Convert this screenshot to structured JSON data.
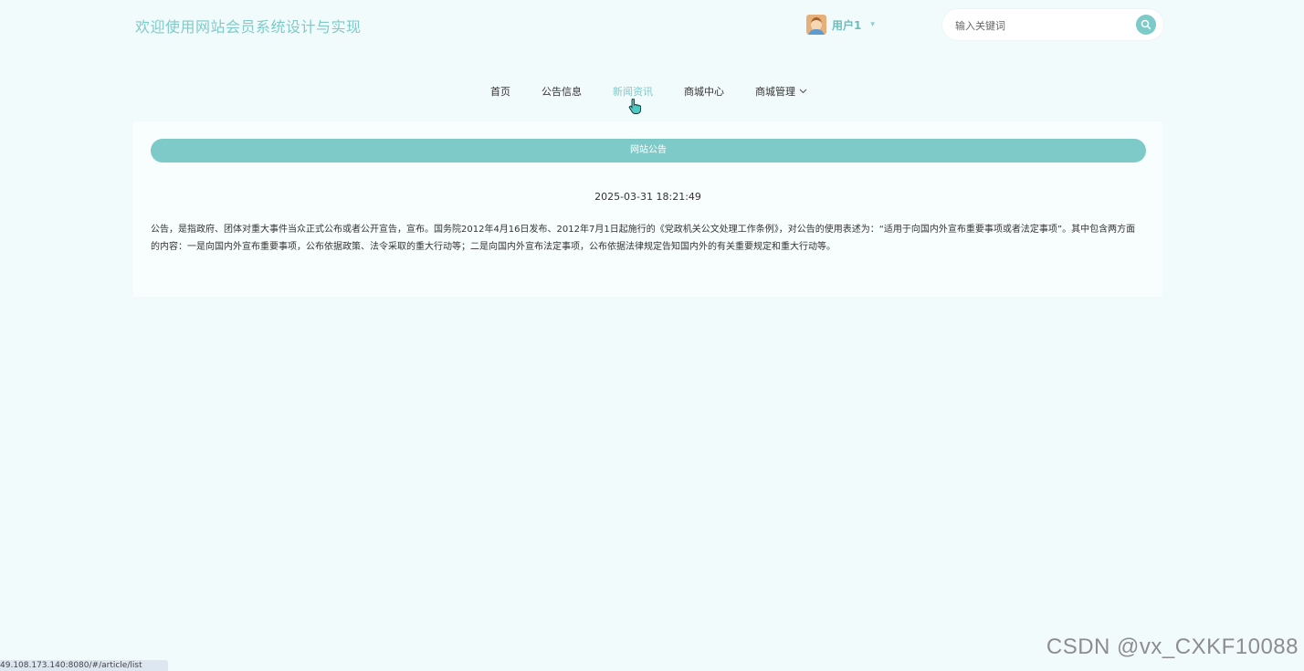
{
  "header": {
    "site_title": "欢迎使用网站会员系统设计与实现",
    "user": {
      "name": "用户1",
      "avatar_icon": "user-avatar-icon",
      "caret_icon": "caret-down-icon"
    },
    "search": {
      "placeholder": "输入关键词",
      "icon": "search-icon"
    }
  },
  "nav": {
    "items": [
      {
        "label": "首页"
      },
      {
        "label": "公告信息"
      },
      {
        "label": "新闻资讯",
        "active": true
      },
      {
        "label": "商城中心"
      },
      {
        "label": "商城管理",
        "has_dropdown": true
      }
    ]
  },
  "panel": {
    "title": "网站公告",
    "date": "2025-03-31 18:21:49",
    "body": "公告，是指政府、团体对重大事件当众正式公布或者公开宣告，宣布。国务院2012年4月16日发布、2012年7月1日起施行的《党政机关公文处理工作条例》，对公告的使用表述为：“适用于向国内外宣布重要事项或者法定事项”。其中包含两方面的内容：一是向国内外宣布重要事项，公布依据政策、法令采取的重大行动等；二是向国内外宣布法定事项，公布依据法律规定告知国内外的有关重要规定和重大行动等。"
  },
  "watermark": "CSDN @vx_CXKF10088",
  "status_bar": {
    "url": "49.108.173.140:8080/#/article/list"
  },
  "colors": {
    "accent": "#7ecac8",
    "background": "#f2fbfc"
  }
}
